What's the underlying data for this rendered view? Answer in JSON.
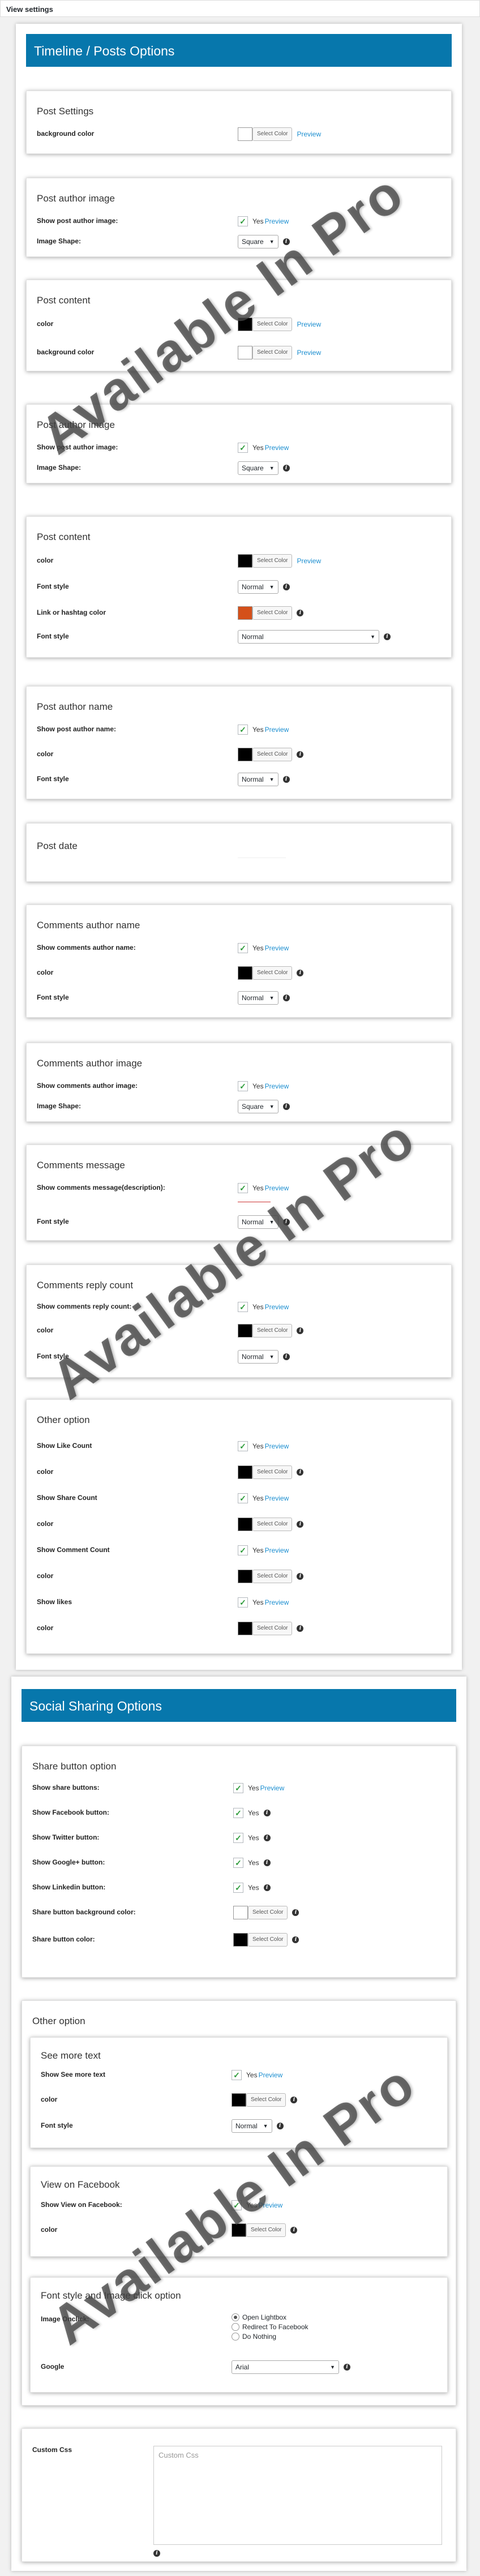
{
  "window": {
    "title": "View settings"
  },
  "timeline": {
    "title": "Timeline / Posts Options",
    "post_settings": {
      "title": "Post Settings",
      "bg_label": "background color",
      "select_color": "Select Color",
      "preview": "Preview"
    },
    "post_author_image": {
      "title": "Post author image",
      "show_label": "Show post author image:",
      "yes": "Yes",
      "preview": "Preview",
      "shape_label": "Image Shape:",
      "shape_value": "Square"
    },
    "post_content_a": {
      "title": "Post content",
      "color_label": "color",
      "bg_label": "background color",
      "select_color": "Select Color",
      "preview": "Preview"
    },
    "post_author_image_b": {
      "title": "Post author image",
      "show_label": "Show post author image:",
      "yes": "Yes",
      "preview": "Preview",
      "shape_label": "Image Shape:",
      "shape_value": "Square"
    },
    "post_content_b": {
      "title": "Post content",
      "color_label": "color",
      "font_style_label": "Font style",
      "font_style_value": "Normal",
      "link_label": "Link or hashtag color",
      "font_style2_label": "Font style",
      "font_style2_value": "Normal",
      "select_color": "Select Color",
      "preview": "Preview"
    },
    "post_author_name": {
      "title": "Post author name",
      "show_label": "Show post author name:",
      "yes": "Yes",
      "preview": "Preview",
      "color_label": "color",
      "select_color": "Select Color",
      "font_style_label": "Font style",
      "font_style_value": "Normal"
    },
    "post_date": {
      "title": "Post date"
    },
    "comments_author_name": {
      "title": "Comments author name",
      "show_label": "Show comments author name:",
      "yes": "Yes",
      "preview": "Preview",
      "color_label": "color",
      "select_color": "Select Color",
      "font_style_label": "Font style",
      "font_style_value": "Normal"
    },
    "comments_author_image": {
      "title": "Comments author image",
      "show_label": "Show comments author image:",
      "yes": "Yes",
      "preview": "Preview",
      "shape_label": "Image Shape:",
      "shape_value": "Square"
    },
    "comments_message": {
      "title": "Comments message",
      "show_label": "Show comments message(description):",
      "yes": "Yes",
      "preview": "Preview",
      "font_style_label": "Font style",
      "font_style_value": "Normal"
    },
    "comments_reply_count": {
      "title": "Comments reply count",
      "show_label": "Show comments reply count:",
      "yes": "Yes",
      "preview": "Preview",
      "color_label": "color",
      "select_color": "Select Color",
      "font_style_label": "Font style",
      "font_style_value": "Normal"
    },
    "other_option": {
      "title": "Other option",
      "like_label": "Show Like Count",
      "share_label": "Show Share Count",
      "comment_label": "Show Comment Count",
      "likes_label": "Show likes",
      "color_label": "color",
      "yes": "Yes",
      "preview": "Preview",
      "select_color": "Select Color"
    }
  },
  "social": {
    "title": "Social Sharing Options",
    "share_button": {
      "title": "Share button option",
      "share_label": "Show share buttons:",
      "fb_label": "Show Facebook button:",
      "tw_label": "Show Twitter button:",
      "gp_label": "Show Google+ button:",
      "li_label": "Show Linkedin button:",
      "bg_label": "Share button background color:",
      "color_label": "Share button color:",
      "yes": "Yes",
      "preview": "Preview",
      "select_color": "Select Color"
    },
    "other": {
      "title": "Other option"
    },
    "see_more": {
      "title": "See more text",
      "show_label": "Show See more text",
      "color_label": "color",
      "font_style_label": "Font style",
      "font_style_value": "Normal",
      "yes": "Yes",
      "preview": "Preview",
      "select_color": "Select Color"
    },
    "view_fb": {
      "title": "View on Facebook",
      "show_label": "Show View on Facebook:",
      "color_label": "color",
      "yes": "Yes",
      "preview": "Preview",
      "select_color": "Select Color"
    },
    "font_image": {
      "title": "Font style and Image click option",
      "onclick_label": "Image Onclick:",
      "options": [
        "Open Lightbox",
        "Redirect To Facebook",
        "Do Nothing"
      ],
      "font_label": "Google",
      "font_value": "Arial"
    },
    "custom_css": {
      "label": "Custom Css",
      "placeholder": "Custom Css"
    }
  },
  "watermark": "Available In Pro",
  "colors": {
    "header": "#0777ac",
    "accent": "#d4501a"
  }
}
